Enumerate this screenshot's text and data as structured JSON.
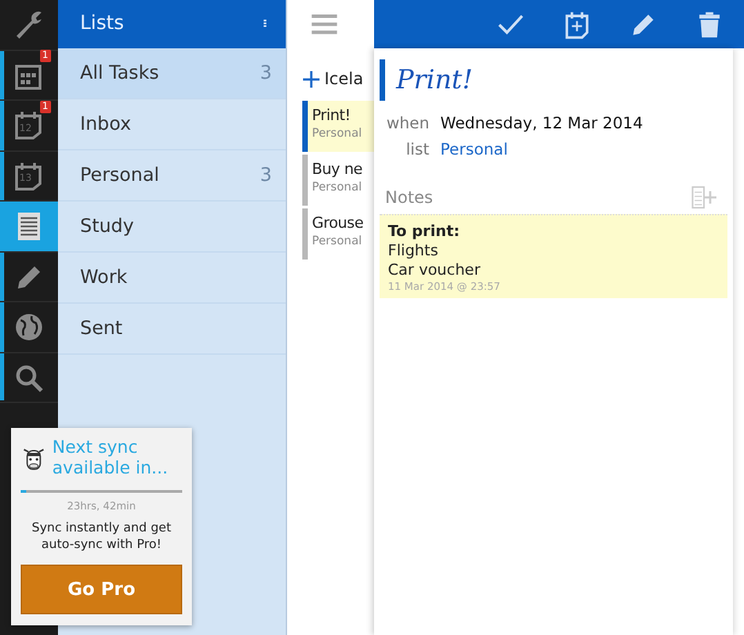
{
  "rail": [
    {
      "kind": "wrench",
      "selected": false
    },
    {
      "kind": "calendar",
      "badge": "1",
      "selected": false
    },
    {
      "kind": "day",
      "day": "12",
      "badge": "1",
      "selected": false
    },
    {
      "kind": "day",
      "day": "13",
      "selected": false
    },
    {
      "kind": "list",
      "selected": true
    },
    {
      "kind": "pencil",
      "selected": false
    },
    {
      "kind": "globe",
      "selected": false
    },
    {
      "kind": "search",
      "selected": false
    }
  ],
  "lists": {
    "title": "Lists",
    "items": [
      {
        "label": "All Tasks",
        "count": "3",
        "selected": true
      },
      {
        "label": "Inbox",
        "selected": false
      },
      {
        "label": "Personal",
        "count": "3",
        "selected": false
      },
      {
        "label": "Study",
        "selected": false
      },
      {
        "label": "Work",
        "selected": false
      },
      {
        "label": "Sent",
        "selected": false
      }
    ]
  },
  "add_task": {
    "label": "Icela"
  },
  "tasks": [
    {
      "title": "Print!",
      "list": "Personal",
      "selected": true
    },
    {
      "title": "Buy ne",
      "list": "Personal",
      "selected": false
    },
    {
      "title": "Grouse",
      "list": "Personal",
      "selected": false
    }
  ],
  "detail": {
    "title": "Print!",
    "fields": [
      {
        "label": "when",
        "value": "Wednesday, 12 Mar 2014",
        "kind": "text"
      },
      {
        "label": "list",
        "value": "Personal",
        "kind": "link"
      }
    ],
    "notes_heading": "Notes",
    "note": {
      "lines": [
        "**To print:**",
        "Flights",
        "Car voucher"
      ],
      "stamp": "11 Mar 2014 @ 23:57"
    }
  },
  "promo": {
    "title": "Next sync available in...",
    "level": 0.03,
    "remaining": "23hrs, 42min",
    "text": "Sync instantly and get auto-sync with Pro!",
    "button": "Go Pro"
  }
}
